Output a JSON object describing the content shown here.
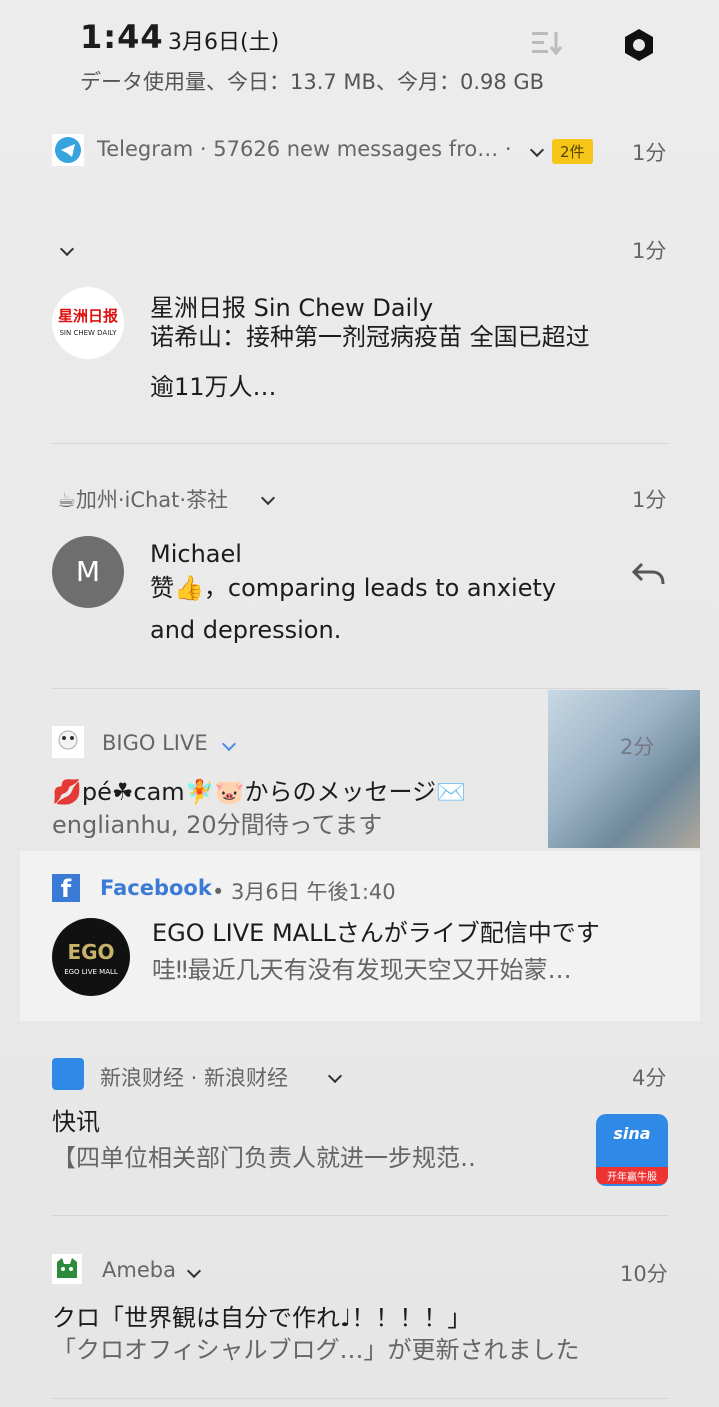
{
  "status": {
    "time": "1:44",
    "date": "3月6日(土)",
    "data_usage": "データ使用量、今日：13.7 MB、今月：0.98 GB"
  },
  "notifications": {
    "telegram": {
      "header": "Telegram · 57626 new messages fro… ·",
      "badge": "2件",
      "time": "1分"
    },
    "sinchew": {
      "time": "1分",
      "logo_text": "星洲日报",
      "logo_sub": "SIN CHEW DAILY",
      "title": "星洲日报 Sin Chew Daily",
      "body_line1": "诺希山：接种第一剂冠病疫苗 全国已超过",
      "body_line2": "逾11万人…"
    },
    "ichat": {
      "header": "☕加州·iChat·茶社",
      "time": "1分",
      "avatar_letter": "M",
      "sender": "Michael",
      "body_line1": "赞👍，comparing leads to anxiety",
      "body_line2": "and depression."
    },
    "bigo": {
      "header": "BIGO LIVE",
      "title": "💋pé☘cam🧚🐷からのメッセージ✉️",
      "sub": "englianhu, 20分間待ってます",
      "time": "2分"
    },
    "facebook": {
      "app": "Facebook",
      "meta": "• 3月6日 午後1:40",
      "title": "EGO LIVE MALLさんがライブ配信中です",
      "body": "哇‼最近几天有没有发现天空又开始蒙…",
      "avatar_text": "EGO",
      "avatar_sub": "EGO LIVE MALL"
    },
    "sina": {
      "header": "新浪财经 · 新浪财经",
      "time": "4分",
      "title": "快讯",
      "body": "【四单位相关部门负责人就进一步规范‥",
      "thumb_text": "sina",
      "thumb_sub": "开年赢牛股"
    },
    "ameba": {
      "header": "Ameba",
      "time": "10分",
      "title": "クロ「世界観は自分で作れ♩！！！！」",
      "body": "「クロオフィシャルブログ…」が更新されました"
    }
  },
  "colors": {
    "facebook_blue": "#3b7bd6",
    "telegram_blue": "#37a3df",
    "ameba_green": "#2e8b3e",
    "sina_blue": "#2e8ae6",
    "bigo_chevron": "#4a8ee8"
  }
}
